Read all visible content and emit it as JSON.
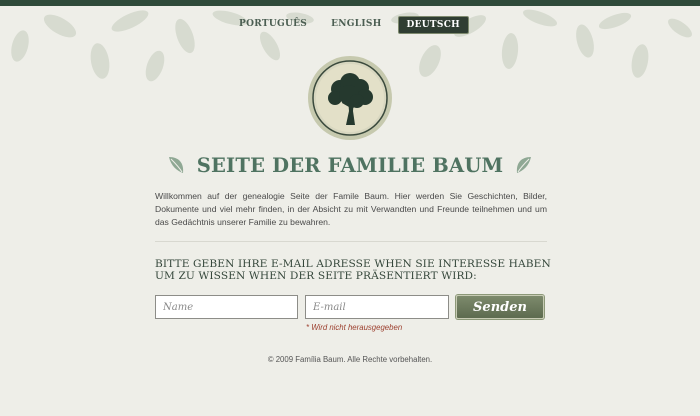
{
  "nav": {
    "languages": [
      {
        "label": "PORTUGUÊS",
        "active": false
      },
      {
        "label": "ENGLISH",
        "active": false
      },
      {
        "label": "DEUTSCH",
        "active": true
      }
    ]
  },
  "page": {
    "title": "SEITE DER FAMILIE BAUM",
    "intro": "Willkommen auf der genealogie Seite der Famile Baum. Hier werden Sie Geschichten, Bilder, Dokumente und viel mehr finden, in der Absicht zu mit Verwandten und Freunde teilnehmen und um das Gedächtnis unserer Familie zu bewahren."
  },
  "signup": {
    "heading_line1": "BITTE GEBEN IHRE E-MAIL ADRESSE WHEN SIE INTERESSE HABEN",
    "heading_line2": "UM ZU WISSEN WHEN DER SEITE PRÄSENTIERT WIRD:",
    "name_placeholder": "Name",
    "email_placeholder": "E-mail",
    "submit_label": "Senden",
    "privacy_note": "* Wird nicht herausgegeben"
  },
  "footer": {
    "copyright": "© 2009 Família Baum. Alle Rechte vorbehalten."
  },
  "colors": {
    "top_strip": "#2f4a3a",
    "title": "#4f7361",
    "active_language_bg": "#2f3d32",
    "button": "#6b785d",
    "note": "#9c3f2e"
  },
  "icons": {
    "logo": "tree-emblem-icon",
    "flourishes": "leaf-flourish-icon"
  }
}
